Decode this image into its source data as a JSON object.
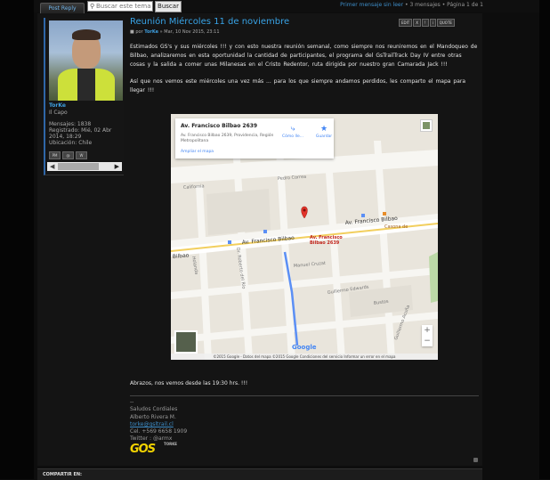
{
  "toolbar": {
    "post_reply": "Post Reply",
    "search_placeholder": "Buscar este tema",
    "search_button": "Buscar",
    "pagination_link": "Primer mensaje sin leer",
    "pagination_text": "• 3 mensajes • Página 1 de 1"
  },
  "profile": {
    "username": "TorKe",
    "rank": "Il Capo",
    "messages": "Mensajes: 1838",
    "registered": "Registrado: Mié, 02 Abr 2014, 18:29",
    "location": "Ubicación: Chile"
  },
  "post": {
    "title": "Reunión Miércoles 11 de noviembre",
    "by": "por",
    "author": "TorKe",
    "date": "» Mar, 10 Nov 2015, 23:11",
    "buttons": [
      "EDIT",
      "X",
      "!",
      "i",
      "QUOTE"
    ],
    "paragraph1": "Estimados GS's y sus miércoles !!! y con esto nuestra reunión semanal, como siempre nos reuniremos en el Mandoqueo de Bilbao, analizaremos en esta oportunidad la cantidad de participantes, el programa del GsTrailTrack Day IV entre otras cosas y la salida a comer unas Milanesas en el Cristo Redentor, ruta dirigida por nuestro gran Camarada Jack !!!",
    "paragraph2": "Así que nos vemos este miércoles una vez más ... para los que siempre andamos perdidos, les comparto el mapa para llegar !!!",
    "closing": "Abrazos, nos vemos desde las 19:30 hrs. !!!"
  },
  "map": {
    "place_name": "Av. Francisco Bilbao 2639",
    "address": "Av. Francisco Bilbao 2639, Providencia, Región Metropolitana",
    "enlarge_link": "Ampliar el mapa",
    "directions": "Cómo lle...",
    "save": "Guardar",
    "pin_label_1": "Av. Francisco",
    "pin_label_2": "Bilbao 2639",
    "footer": "©2015 Google - Datos del mapa ©2015 Google   Condiciones del servicio   Informar un error en el mapa",
    "google": "Google",
    "streets": {
      "bilbao_main": "Av. Francisco Bilbao",
      "bilbao_left": "Bilbao",
      "bilbao_right": "Av. Francisco Bilbao",
      "california": "California",
      "pedro_correa": "Pedro Correa",
      "holanda": "Holanda",
      "roberto_rio": "Dr. Roberto del Río",
      "manuel_cruzat": "Manuel Cruzat",
      "guillermo_edwards": "Guillermo Edwards",
      "guillermo_acuna": "Guillermo Acuña",
      "bustos": "Bustos",
      "casona": "Casona de"
    }
  },
  "signature": {
    "dashes": "--",
    "line1": "Saludos Cordiales",
    "line2": "Alberto Rivera M.",
    "email": "torke@gsltrail.cl",
    "phone": "Cel. +569 6658 1909",
    "twitter": "Twitter : @armx",
    "logo_text": "GOS",
    "logo_tag": "TORKE"
  },
  "footer": {
    "share": "COMPARTIR EN:"
  }
}
